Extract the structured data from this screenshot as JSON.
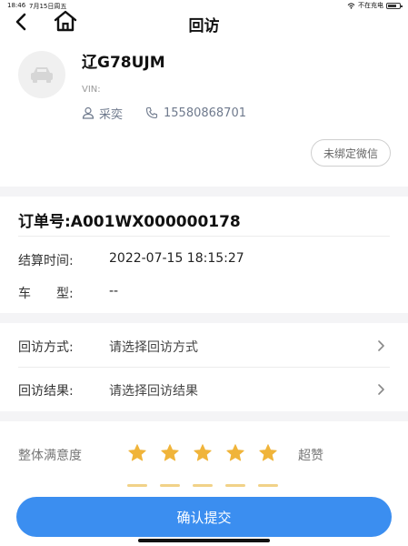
{
  "status": {
    "time": "18:46",
    "date": "7月15日周五",
    "charging": "不在充电"
  },
  "nav": {
    "title": "回访"
  },
  "customer": {
    "plate": "辽G78UJM",
    "vin_label": "VIN:",
    "owner": "采奕",
    "phone": "15580868701",
    "wechat_button": "未绑定微信"
  },
  "order": {
    "number": "订单号:A001WX000000178",
    "settle_label": "结算时间:",
    "settle_time": "2022-07-15 18:15:27",
    "model_label": "车　　型:",
    "model_value": "--"
  },
  "visit": {
    "method_label": "回访方式:",
    "method_placeholder": "请选择回访方式",
    "result_label": "回访结果:",
    "result_placeholder": "请选择回访结果"
  },
  "satisfaction": {
    "label": "整体满意度",
    "rating": 5,
    "max": 5,
    "value_text": "超赞"
  },
  "submit_label": "确认提交",
  "colors": {
    "accent": "#3b8ef0",
    "star": "#f0b43a",
    "section_gap": "#f4f4f6"
  }
}
